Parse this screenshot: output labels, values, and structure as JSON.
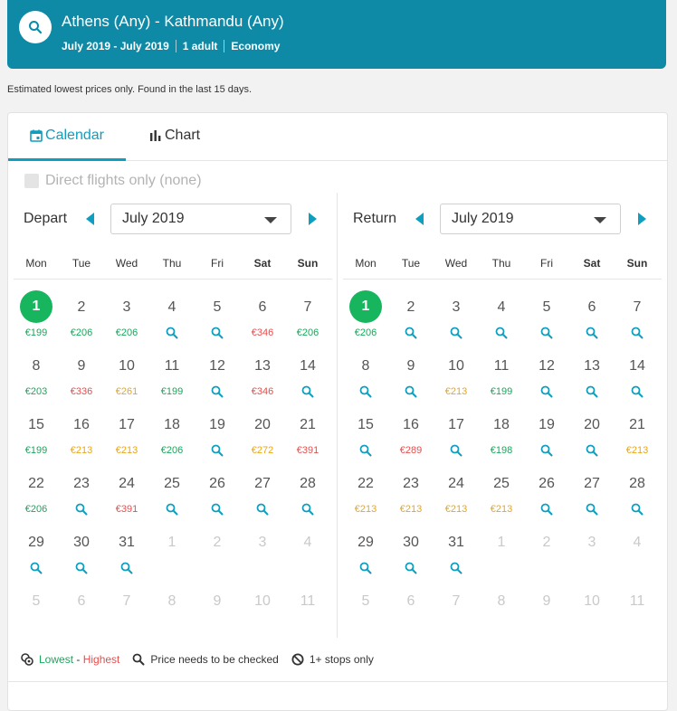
{
  "header": {
    "route": "Athens (Any) - Kathmandu (Any)",
    "dates": "July 2019 - July 2019",
    "travellers": "1 adult",
    "cabin": "Economy"
  },
  "notice": "Estimated lowest prices only. Found in the last 15 days.",
  "tabs": {
    "calendar": "Calendar",
    "chart": "Chart"
  },
  "direct_label": "Direct flights only (none)",
  "depart": {
    "label": "Depart",
    "month": "July 2019",
    "weekdays": [
      "Mon",
      "Tue",
      "Wed",
      "Thu",
      "Fri",
      "Sat",
      "Sun"
    ],
    "days": [
      {
        "d": "1",
        "p": "€199",
        "c": "low",
        "sel": true
      },
      {
        "d": "2",
        "p": "€206",
        "c": "low"
      },
      {
        "d": "3",
        "p": "€206",
        "c": "low"
      },
      {
        "d": "4",
        "s": true
      },
      {
        "d": "5",
        "s": true
      },
      {
        "d": "6",
        "p": "€346",
        "c": "high"
      },
      {
        "d": "7",
        "p": "€206",
        "c": "low"
      },
      {
        "d": "8",
        "p": "€203",
        "c": "low"
      },
      {
        "d": "9",
        "p": "€336",
        "c": "high"
      },
      {
        "d": "10",
        "p": "€261",
        "c": "mid"
      },
      {
        "d": "11",
        "p": "€199",
        "c": "low"
      },
      {
        "d": "12",
        "s": true
      },
      {
        "d": "13",
        "p": "€346",
        "c": "high"
      },
      {
        "d": "14",
        "s": true
      },
      {
        "d": "15",
        "p": "€199",
        "c": "low"
      },
      {
        "d": "16",
        "p": "€213",
        "c": "mid"
      },
      {
        "d": "17",
        "p": "€213",
        "c": "mid"
      },
      {
        "d": "18",
        "p": "€206",
        "c": "low"
      },
      {
        "d": "19",
        "s": true
      },
      {
        "d": "20",
        "p": "€272",
        "c": "mid"
      },
      {
        "d": "21",
        "p": "€391",
        "c": "high"
      },
      {
        "d": "22",
        "p": "€206",
        "c": "low"
      },
      {
        "d": "23",
        "s": true
      },
      {
        "d": "24",
        "p": "€391",
        "c": "high"
      },
      {
        "d": "25",
        "s": true
      },
      {
        "d": "26",
        "s": true
      },
      {
        "d": "27",
        "s": true
      },
      {
        "d": "28",
        "s": true
      },
      {
        "d": "29",
        "s": true
      },
      {
        "d": "30",
        "s": true
      },
      {
        "d": "31",
        "s": true
      },
      {
        "d": "1",
        "m": true
      },
      {
        "d": "2",
        "m": true
      },
      {
        "d": "3",
        "m": true
      },
      {
        "d": "4",
        "m": true
      },
      {
        "d": "5",
        "m": true
      },
      {
        "d": "6",
        "m": true
      },
      {
        "d": "7",
        "m": true
      },
      {
        "d": "8",
        "m": true
      },
      {
        "d": "9",
        "m": true
      },
      {
        "d": "10",
        "m": true
      },
      {
        "d": "11",
        "m": true
      }
    ]
  },
  "return": {
    "label": "Return",
    "month": "July 2019",
    "weekdays": [
      "Mon",
      "Tue",
      "Wed",
      "Thu",
      "Fri",
      "Sat",
      "Sun"
    ],
    "days": [
      {
        "d": "1",
        "p": "€206",
        "c": "low",
        "sel": true
      },
      {
        "d": "2",
        "s": true
      },
      {
        "d": "3",
        "s": true
      },
      {
        "d": "4",
        "s": true
      },
      {
        "d": "5",
        "s": true
      },
      {
        "d": "6",
        "s": true
      },
      {
        "d": "7",
        "s": true
      },
      {
        "d": "8",
        "s": true
      },
      {
        "d": "9",
        "s": true
      },
      {
        "d": "10",
        "p": "€213",
        "c": "mid"
      },
      {
        "d": "11",
        "p": "€199",
        "c": "low"
      },
      {
        "d": "12",
        "s": true
      },
      {
        "d": "13",
        "s": true
      },
      {
        "d": "14",
        "s": true
      },
      {
        "d": "15",
        "s": true
      },
      {
        "d": "16",
        "p": "€289",
        "c": "high"
      },
      {
        "d": "17",
        "s": true
      },
      {
        "d": "18",
        "p": "€198",
        "c": "low"
      },
      {
        "d": "19",
        "s": true
      },
      {
        "d": "20",
        "s": true
      },
      {
        "d": "21",
        "p": "€213",
        "c": "mid"
      },
      {
        "d": "22",
        "p": "€213",
        "c": "mid"
      },
      {
        "d": "23",
        "p": "€213",
        "c": "mid"
      },
      {
        "d": "24",
        "p": "€213",
        "c": "mid"
      },
      {
        "d": "25",
        "p": "€213",
        "c": "mid"
      },
      {
        "d": "26",
        "s": true
      },
      {
        "d": "27",
        "s": true
      },
      {
        "d": "28",
        "s": true
      },
      {
        "d": "29",
        "s": true
      },
      {
        "d": "30",
        "s": true
      },
      {
        "d": "31",
        "s": true
      },
      {
        "d": "1",
        "m": true
      },
      {
        "d": "2",
        "m": true
      },
      {
        "d": "3",
        "m": true
      },
      {
        "d": "4",
        "m": true
      },
      {
        "d": "5",
        "m": true
      },
      {
        "d": "6",
        "m": true
      },
      {
        "d": "7",
        "m": true
      },
      {
        "d": "8",
        "m": true
      },
      {
        "d": "9",
        "m": true
      },
      {
        "d": "10",
        "m": true
      },
      {
        "d": "11",
        "m": true
      }
    ]
  },
  "legend": {
    "lowest": "Lowest",
    "dash": " - ",
    "highest": "Highest",
    "check": "Price needs to be checked",
    "stops": "1+ stops only"
  },
  "colors": {
    "brand": "#0e8aa7",
    "accent": "#0e9fc0",
    "selected": "#17b55e",
    "low": "#1ba65c",
    "mid": "#e8a61a",
    "high": "#e84d4d"
  }
}
